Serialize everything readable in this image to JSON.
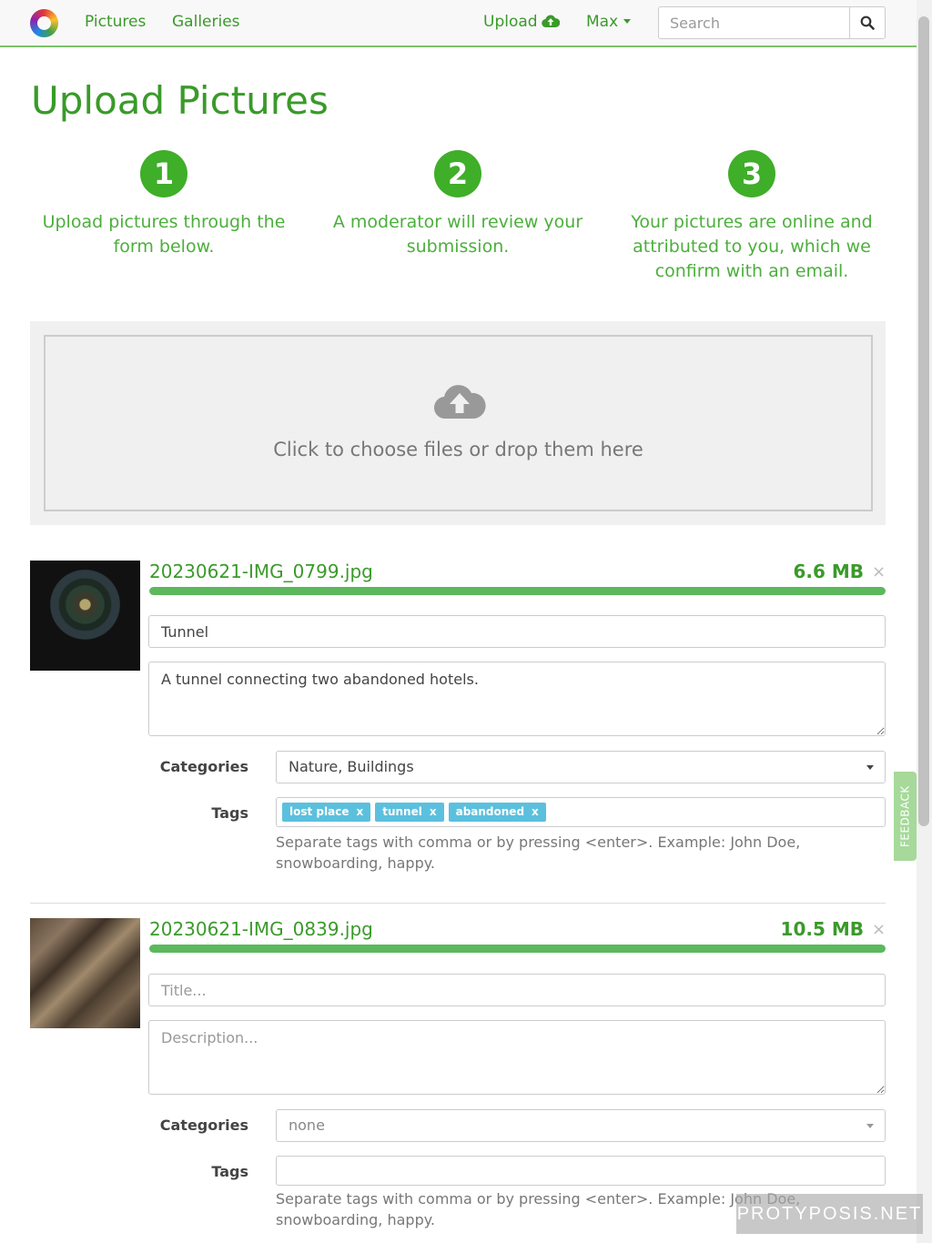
{
  "nav": {
    "pictures": "Pictures",
    "galleries": "Galleries",
    "upload": "Upload",
    "user": "Max",
    "search_placeholder": "Search"
  },
  "page": {
    "title": "Upload Pictures",
    "steps": [
      {
        "num": "1",
        "text": "Upload pictures through the form below."
      },
      {
        "num": "2",
        "text": "A moderator will review your submission."
      },
      {
        "num": "3",
        "text": "Your pictures are online and attributed to you, which we confirm with an email."
      }
    ],
    "dropzone_text": "Click to choose files or drop them here"
  },
  "files": [
    {
      "name": "20230621-IMG_0799.jpg",
      "size": "6.6 MB",
      "progress": 1.0,
      "title_value": "Tunnel",
      "title_placeholder": "Title...",
      "description_value": "A tunnel connecting two abandoned hotels.",
      "description_placeholder": "Description...",
      "categories_label": "Categories",
      "categories_value": "Nature, Buildings",
      "tags_label": "Tags",
      "tags": [
        "lost place",
        "tunnel",
        "abandoned"
      ],
      "help": "Separate tags with comma or by pressing <enter>. Example: John Doe, snowboarding, happy."
    },
    {
      "name": "20230621-IMG_0839.jpg",
      "size": "10.5 MB",
      "progress": 1.0,
      "title_value": "",
      "title_placeholder": "Title...",
      "description_value": "",
      "description_placeholder": "Description...",
      "categories_label": "Categories",
      "categories_value": "none",
      "tags_label": "Tags",
      "tags": [],
      "help": "Separate tags with comma or by pressing <enter>. Example: John Doe, snowboarding, happy."
    }
  ],
  "feedback": "FEEDBACK",
  "watermark": "PROTYPOSIS.NET",
  "remove_symbol": "×",
  "tag_remove_symbol": "x",
  "colors": {
    "brand_green": "#3a9a2a",
    "step_green": "#3fae29",
    "progress": "#5cb85c",
    "tag": "#5bc0de"
  },
  "icons": {
    "logo": "color-ring-logo",
    "upload": "cloud-upload-icon",
    "search": "search-icon",
    "dropzone": "cloud-upload-icon"
  }
}
